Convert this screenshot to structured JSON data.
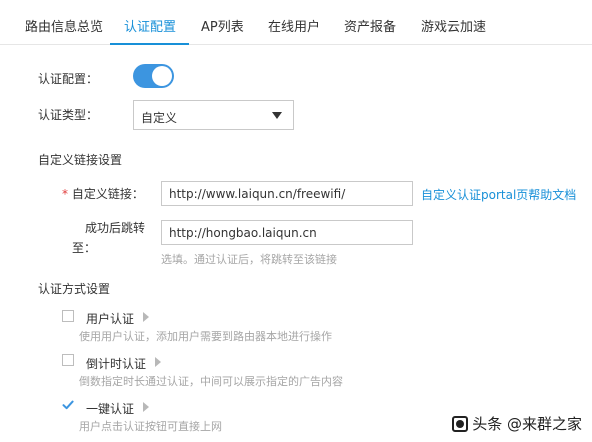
{
  "tabs": [
    {
      "label": "路由信息总览"
    },
    {
      "label": "认证配置"
    },
    {
      "label": "AP列表"
    },
    {
      "label": "在线用户"
    },
    {
      "label": "资产报备"
    },
    {
      "label": "游戏云加速"
    }
  ],
  "auth_config": {
    "label": "认证配置：",
    "enabled": true
  },
  "auth_type": {
    "label": "认证类型：",
    "value": "自定义"
  },
  "custom_link_section": {
    "title": "自定义链接设置"
  },
  "custom_link": {
    "required_mark": "*",
    "label": "自定义链接：",
    "value": "http://www.laiqun.cn/freewifi/",
    "help_link": "自定义认证portal页帮助文档"
  },
  "redirect": {
    "label_line1": "成功后跳转",
    "label_line2": "至：",
    "value": "http://hongbao.laiqun.cn",
    "hint": "选填。通过认证后，将跳转至该链接"
  },
  "auth_methods": {
    "title": "认证方式设置",
    "items": [
      {
        "label": "用户认证",
        "desc": "使用用户认证，添加用户需要到路由器本地进行操作",
        "checked": false
      },
      {
        "label": "倒计时认证",
        "desc": "倒数指定时长通过认证，中间可以展示指定的广告内容",
        "checked": false
      },
      {
        "label": "一键认证",
        "desc": "用户点击认证按钮可直接上网",
        "checked": true
      }
    ]
  },
  "watermark": {
    "text": "头条 @来群之家"
  },
  "colors": {
    "accent": "#1890d8",
    "toggle_on": "#3c95e0",
    "checkbox_checked": "#3c95e0"
  }
}
